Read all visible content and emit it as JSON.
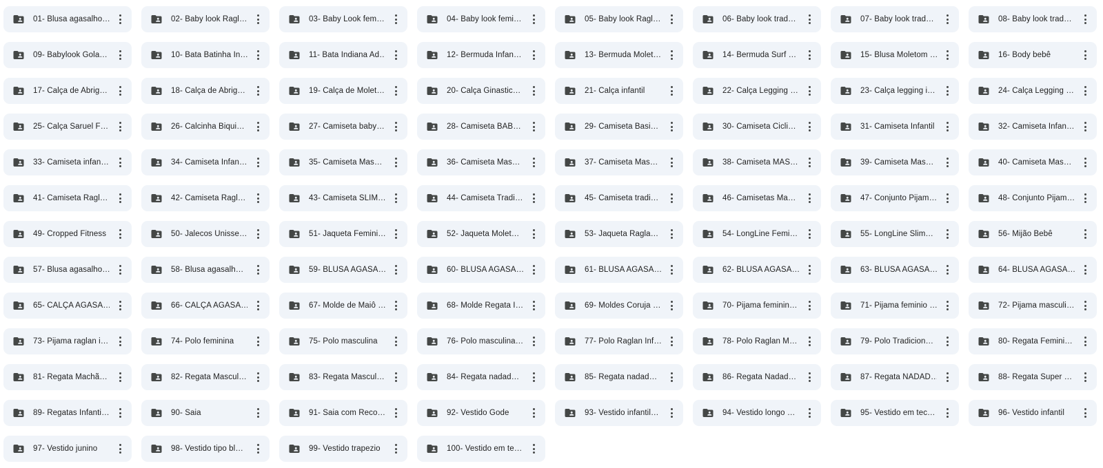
{
  "colors": {
    "tile_bg": "#f0f4f9",
    "text": "#1f1f1f",
    "icon": "#444746"
  },
  "icons": {
    "folder": "shared-folder-icon",
    "more": "more-vertical-icon"
  },
  "folders": [
    "01- Blusa agasalho…",
    "02- Baby look Ragl…",
    "03- Baby Look fem…",
    "04- Baby look femi…",
    "05- Baby look Ragl…",
    "06- Baby look trad…",
    "07- Baby look trad…",
    "08- Baby look trad…",
    "09- Babylook Gola…",
    "10- Bata Batinha In…",
    "11- Bata Indiana Ad…",
    "12- Bermuda Infan…",
    "13- Bermuda Molet…",
    "14- Bermuda Surf …",
    "15- Blusa Moletom …",
    "16- Body bebê",
    "17- Calça de Abrig…",
    "18- Calça de Abrig…",
    "19- Calça de Molet…",
    "20- Calça Ginastic…",
    "21- Calça infantil",
    "22- Calça Legging …",
    "23- Calça legging i…",
    "24- Calça Legging …",
    "25- Calça Saruel F…",
    "26- Calcinha Biqui…",
    "27- Camiseta baby…",
    "28- Camiseta BAB…",
    "29- Camiseta Basi…",
    "30- Camiseta Cicli…",
    "31- Camiseta Infantil",
    "32- Camiseta Infan…",
    "33- Camiseta infan…",
    "34- Camiseta Infan…",
    "35- Camiseta Mas…",
    "36- Camiseta Mas…",
    "37- Camiseta Mas…",
    "38- Camiseta MAS…",
    "39- Camiseta Mas…",
    "40- Camiseta Mas…",
    "41- Camiseta Ragl…",
    "42- Camiseta Ragl…",
    "43- Camiseta SLIM…",
    "44- Camiseta Tradi…",
    "45- Camiseta tradi…",
    "46- Camisetas Ma…",
    "47- Conjunto Pijam…",
    "48- Conjunto Pijam…",
    "49- Cropped Fitness",
    "50- Jalecos Unisse…",
    "51- Jaqueta Femini…",
    "52- Jaqueta Molet…",
    "53- Jaqueta Ragla…",
    "54- LongLine Femi…",
    "55- LongLine Slim…",
    "56- Mijão Bebê",
    "57- Blusa agasalho…",
    "58- Blusa agasalh…",
    "59- BLUSA AGASA…",
    "60- BLUSA AGASA…",
    "61- BLUSA AGASA…",
    "62- BLUSA AGASA…",
    "63- BLUSA AGASA…",
    "64- BLUSA AGASA…",
    "65- CALÇA AGASA…",
    "66- CALÇA AGASA…",
    "67- Molde de Maiô …",
    "68- Molde Regata I…",
    "69- Moldes Coruja …",
    "70- Pijama feminin…",
    "71- Pijama feminio …",
    "72- Pijama masculi…",
    "73- Pijama raglan i…",
    "74- Polo feminina",
    "75- Polo masculina",
    "76- Polo masculina…",
    "77- Polo Raglan Inf…",
    "78- Polo Raglan M…",
    "79- Polo Tradicion…",
    "80- Regata Femini…",
    "81- Regata Machã…",
    "82- Regata Mascul…",
    "83- Regata Mascul…",
    "84- Regata nadad…",
    "85- Regata nadad…",
    "86- Regata Nadad…",
    "87- Regata NADAD…",
    "88- Regata Super …",
    "89- Regatas Infanti…",
    "90- Saia",
    "91- Saia com Reco…",
    "92- Vestido Gode",
    "93- Vestido infantil…",
    "94- Vestido longo …",
    "95- Vestido em tec…",
    "96- Vestido infantil",
    "97- Vestido junino",
    "98- Vestido tipo bl…",
    "99- Vestido trapezio",
    "100- Vestido em te…"
  ]
}
